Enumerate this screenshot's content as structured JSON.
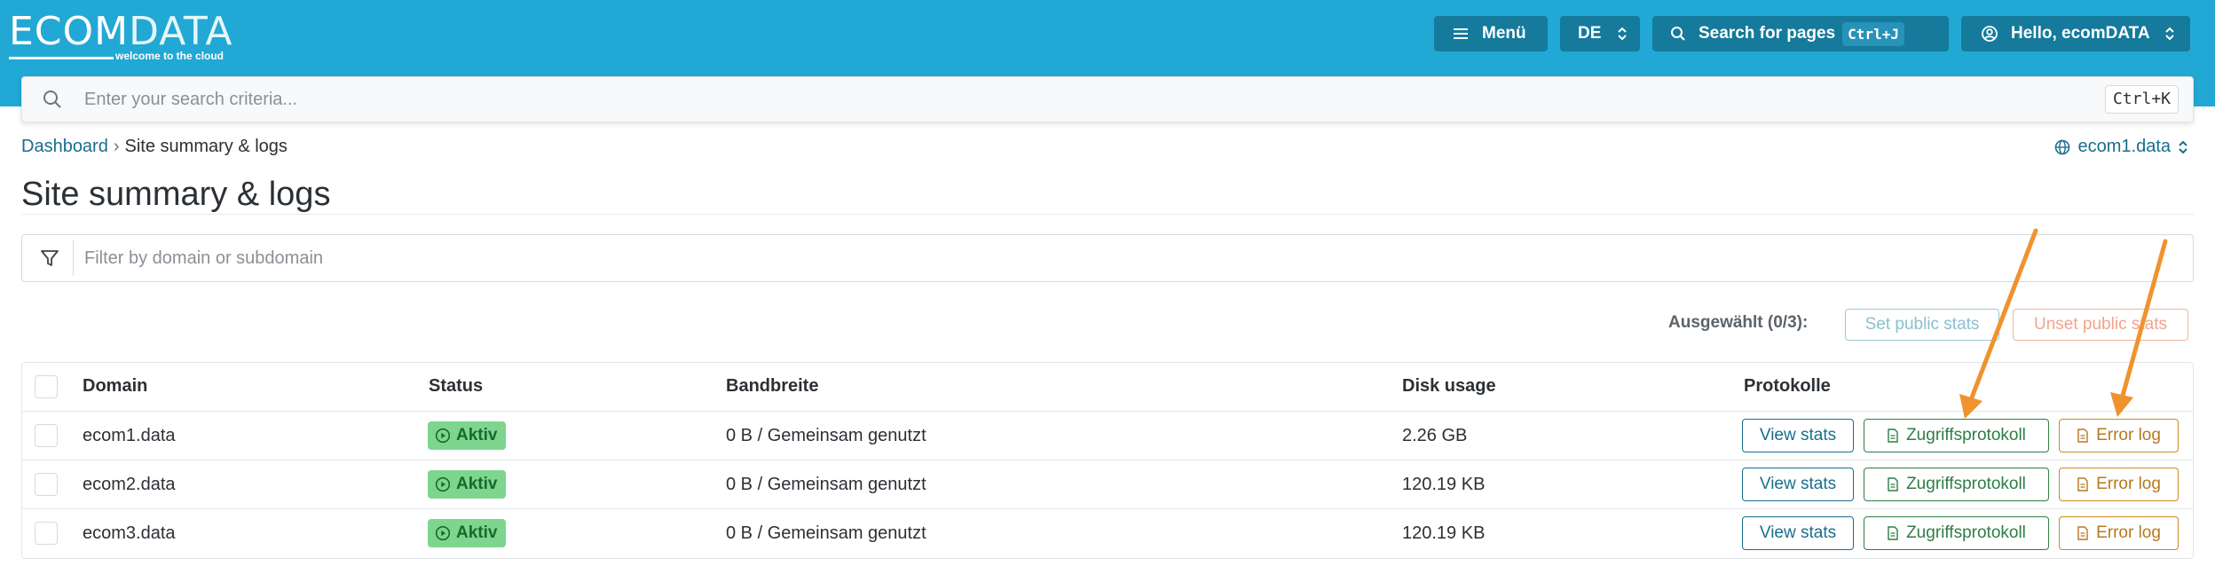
{
  "header": {
    "logo_main": "ECOM",
    "logo_data": "DATA",
    "logo_tagline": "welcome to the cloud",
    "menu_label": "Menü",
    "language": "DE",
    "page_search_label": "Search for pages",
    "page_search_shortcut": "Ctrl+J",
    "user_label": "Hello, ecomDATA"
  },
  "search": {
    "placeholder": "Enter your search criteria...",
    "shortcut": "Ctrl+K"
  },
  "breadcrumb": {
    "home": "Dashboard",
    "separator": "›",
    "current": "Site summary & logs"
  },
  "site_selector": {
    "value": "ecom1.data"
  },
  "page": {
    "title": "Site summary & logs"
  },
  "filter": {
    "placeholder": "Filter by domain or subdomain"
  },
  "selection": {
    "label": "Ausgewählt (0/3):",
    "set_public": "Set public stats",
    "unset_public": "Unset public stats"
  },
  "table": {
    "headers": [
      "Domain",
      "Status",
      "Bandbreite",
      "Disk usage",
      "Protokolle"
    ],
    "rows": [
      {
        "domain": "ecom1.data",
        "status": "Aktiv",
        "bandwidth": "0 B / Gemeinsam genutzt",
        "disk": "2.26 GB",
        "view": "View stats",
        "access": "Zugriffsprotokoll",
        "error": "Error log"
      },
      {
        "domain": "ecom2.data",
        "status": "Aktiv",
        "bandwidth": "0 B / Gemeinsam genutzt",
        "disk": "120.19 KB",
        "view": "View stats",
        "access": "Zugriffsprotokoll",
        "error": "Error log"
      },
      {
        "domain": "ecom3.data",
        "status": "Aktiv",
        "bandwidth": "0 B / Gemeinsam genutzt",
        "disk": "120.19 KB",
        "view": "View stats",
        "access": "Zugriffsprotokoll",
        "error": "Error log"
      }
    ]
  },
  "colors": {
    "header_bg": "#22a8d4",
    "header_button": "#157a9b",
    "active_badge": "#7ed58e",
    "annotation_arrow": "#f0922e"
  },
  "icons": [
    "menu-icon",
    "chevron-updown-icon",
    "search-icon",
    "user-circle-icon",
    "globe-icon",
    "filter-icon",
    "play-circle-icon",
    "file-icon"
  ]
}
